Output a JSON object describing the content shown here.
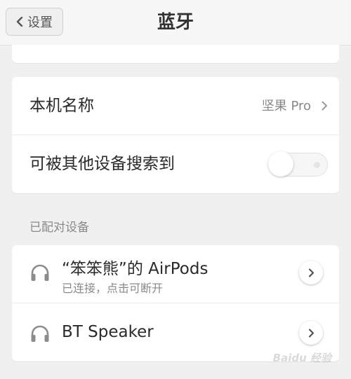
{
  "header": {
    "back_label": "设置",
    "title": "蓝牙"
  },
  "settings": {
    "device_name_label": "本机名称",
    "device_name_value": "坚果 Pro",
    "discoverable_label": "可被其他设备搜索到",
    "discoverable_enabled": false
  },
  "paired": {
    "section_title": "已配对设备",
    "devices": [
      {
        "name": "“笨笨熊”的 AirPods",
        "status": "已连接，点击可断开",
        "icon": "headphones-icon"
      },
      {
        "name": "BT Speaker",
        "icon": "headphones-icon"
      }
    ]
  },
  "watermark": "Baidu 经验",
  "colors": {
    "background": "#f0f0f0",
    "card": "#ffffff",
    "secondary_text": "#8a8a8a"
  }
}
